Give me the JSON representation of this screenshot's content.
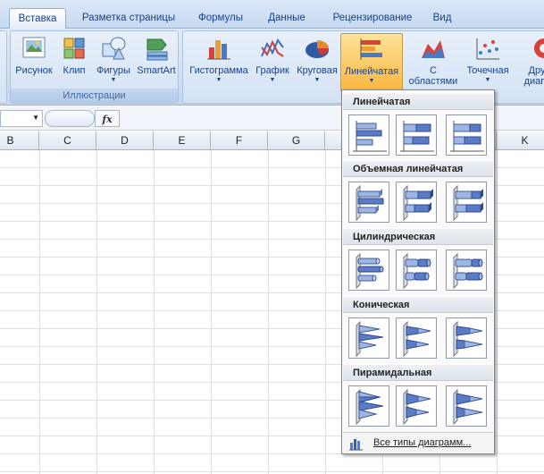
{
  "tabs": [
    {
      "label": "Вставка",
      "active": true
    },
    {
      "label": "Разметка страницы"
    },
    {
      "label": "Формулы"
    },
    {
      "label": "Данные"
    },
    {
      "label": "Рецензирование"
    },
    {
      "label": "Вид"
    }
  ],
  "ribbon": {
    "illustrations": {
      "label": "Иллюстрации",
      "buttons": [
        {
          "label": "Рисунок",
          "icon": "picture-icon"
        },
        {
          "label": "Клип",
          "icon": "clip-art-icon"
        },
        {
          "label": "Фигуры",
          "icon": "shapes-icon"
        },
        {
          "label": "SmartArt",
          "icon": "smartart-icon"
        }
      ]
    },
    "charts": {
      "buttons": [
        {
          "label": "Гистограмма",
          "icon": "column-chart-icon"
        },
        {
          "label": "График",
          "icon": "line-chart-icon"
        },
        {
          "label": "Круговая",
          "icon": "pie-chart-icon"
        },
        {
          "label": "Линейчатая",
          "icon": "bar-chart-icon",
          "pressed": true
        },
        {
          "label": "С",
          "label2": "областями",
          "icon": "area-chart-icon"
        },
        {
          "label": "Точечная",
          "icon": "scatter-chart-icon"
        },
        {
          "label": "Дру",
          "label2": "диагр",
          "icon": "other-charts-icon"
        }
      ]
    }
  },
  "formula_bar": {
    "fx": "fx"
  },
  "columns": [
    "B",
    "C",
    "D",
    "E",
    "F",
    "G",
    "",
    "",
    "",
    "K"
  ],
  "dropdown": {
    "sections": [
      {
        "title": "Линейчатая"
      },
      {
        "title": "Объемная линейчатая"
      },
      {
        "title": "Цилиндрическая"
      },
      {
        "title": "Коническая"
      },
      {
        "title": "Пирамидальная"
      }
    ],
    "footer": "Все типы диаграмм..."
  },
  "colors": {
    "accent": "#15428b",
    "pressed": "#fbb53e",
    "bar": "#5b7bc6"
  }
}
